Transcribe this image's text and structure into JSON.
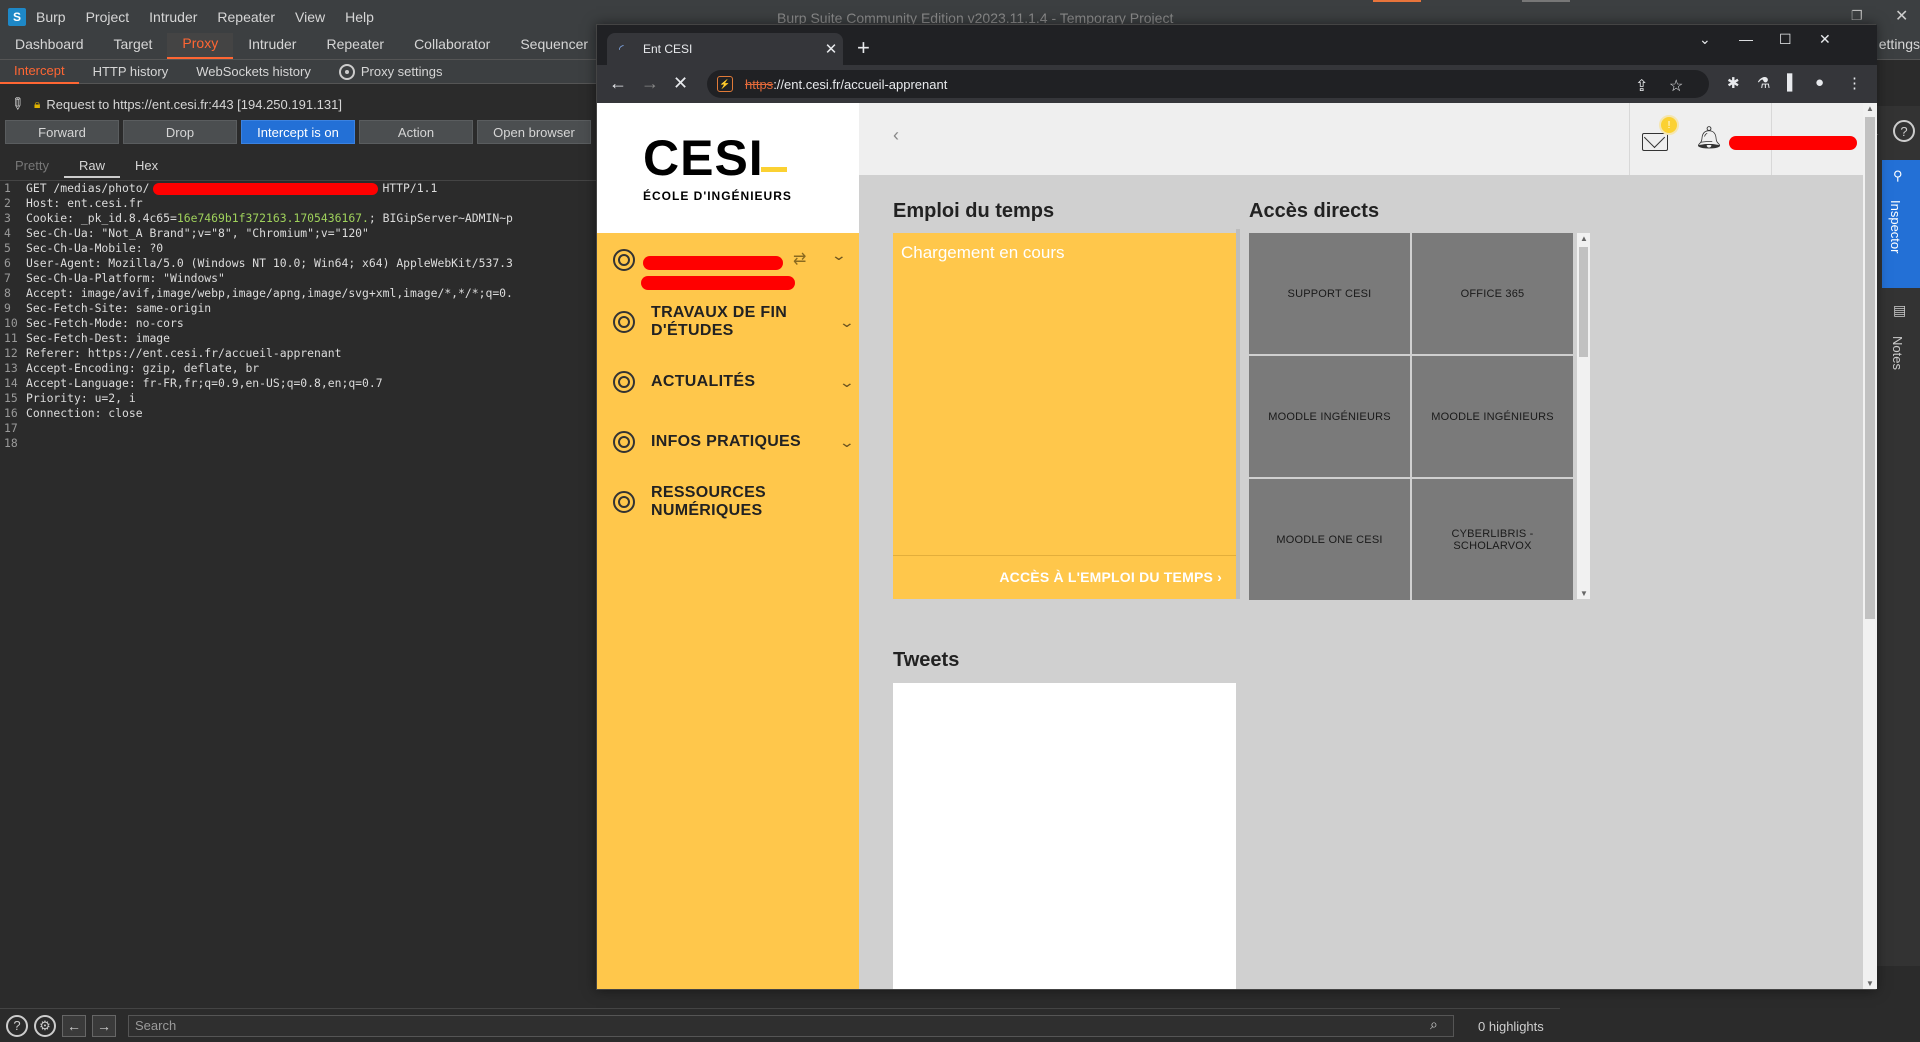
{
  "burp": {
    "logo": "S",
    "menu": [
      "Burp",
      "Project",
      "Intruder",
      "Repeater",
      "View",
      "Help"
    ],
    "window_title": "Burp Suite Community Edition v2023.11.1.4 - Temporary Project",
    "main_tabs": [
      "Dashboard",
      "Target",
      "Proxy",
      "Intruder",
      "Repeater",
      "Collaborator",
      "Sequencer"
    ],
    "settings_label": "ettings",
    "proxy_tabs": [
      "Intercept",
      "HTTP history",
      "WebSockets history",
      "Proxy settings"
    ],
    "request_label": "Request to https://ent.cesi.fr:443  [194.250.191.131]",
    "buttons": {
      "forward": "Forward",
      "drop": "Drop",
      "intercept": "Intercept is on",
      "action": "Action",
      "open_browser": "Open browser"
    },
    "view_tabs": [
      "Pretty",
      "Raw",
      "Hex"
    ],
    "request_lines": [
      {
        "n": "1",
        "pre": "GET /medias/photo/",
        "post": "HTTP/1.1"
      },
      {
        "n": "2",
        "text": "Host: ent.cesi.fr"
      },
      {
        "n": "3",
        "pre": "Cookie: _pk_id.8.4c65=",
        "cookie": "16e7469b1f372163.1705436167.",
        "post": "; BIGipServer~ADMIN~p"
      },
      {
        "n": "4",
        "text": "Sec-Ch-Ua: \"Not_A Brand\";v=\"8\", \"Chromium\";v=\"120\""
      },
      {
        "n": "5",
        "text": "Sec-Ch-Ua-Mobile: ?0"
      },
      {
        "n": "6",
        "text": "User-Agent: Mozilla/5.0 (Windows NT 10.0; Win64; x64) AppleWebKit/537.3"
      },
      {
        "n": "7",
        "text": "Sec-Ch-Ua-Platform: \"Windows\""
      },
      {
        "n": "8",
        "text": "Accept: image/avif,image/webp,image/apng,image/svg+xml,image/*,*/*;q=0."
      },
      {
        "n": "9",
        "text": "Sec-Fetch-Site: same-origin"
      },
      {
        "n": "10",
        "text": "Sec-Fetch-Mode: no-cors"
      },
      {
        "n": "11",
        "text": "Sec-Fetch-Dest: image"
      },
      {
        "n": "12",
        "text": "Referer: https://ent.cesi.fr/accueil-apprenant"
      },
      {
        "n": "13",
        "text": "Accept-Encoding: gzip, deflate, br"
      },
      {
        "n": "14",
        "text": "Accept-Language: fr-FR,fr;q=0.9,en-US;q=0.8,en;q=0.7"
      },
      {
        "n": "15",
        "text": "Priority: u=2, i"
      },
      {
        "n": "16",
        "text": "Connection: close"
      },
      {
        "n": "17",
        "text": ""
      },
      {
        "n": "18",
        "text": ""
      }
    ],
    "search_placeholder": "Search",
    "highlights": "0 highlights",
    "side_tabs": {
      "inspector": "Inspector",
      "notes": "Notes",
      "count": "1"
    }
  },
  "chrome": {
    "tab_title": "Ent CESI",
    "url_scheme": "https",
    "url_rest": "://ent.cesi.fr/accueil-apprenant"
  },
  "cesi": {
    "logo_text": "CESI",
    "logo_sub": "ÉCOLE D'INGÉNIEURS",
    "nav": [
      {
        "label": "TRAVAUX DE FIN D'ÉTUDES",
        "chevron": true
      },
      {
        "label": "ACTUALITÉS",
        "chevron": true
      },
      {
        "label": "INFOS PRATIQUES",
        "chevron": true
      },
      {
        "label": "RESSOURCES NUMÉRIQUES",
        "chevron": false
      }
    ],
    "edt_title": "Emploi du temps",
    "edt_loading": "Chargement en cours",
    "edt_link": "ACCÈS À L'EMPLOI DU TEMPS",
    "acces_title": "Accès directs",
    "tiles": [
      "SUPPORT CESI",
      "OFFICE 365",
      "MOODLE INGÉNIEURS",
      "MOODLE INGÉNIEURS",
      "MOODLE ONE CESI",
      "CYBERLIBRIS - SCHOLARVOX"
    ],
    "tweets_title": "Tweets",
    "colors": {
      "yellow": "#ffc74b",
      "tile_gray": "#7a7a7a",
      "redaction": "#ff0000",
      "burp_orange": "#ff6633",
      "burp_blue": "#2370d6"
    }
  }
}
